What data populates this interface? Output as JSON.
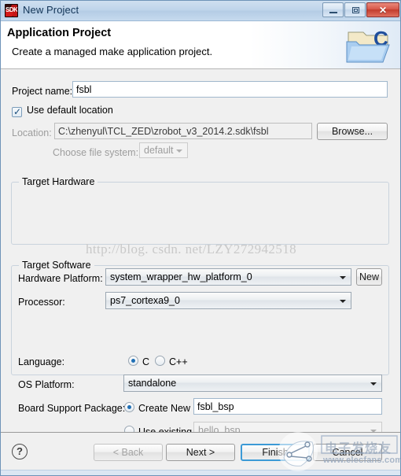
{
  "window": {
    "title": "New Project",
    "icon": "sdk-icon",
    "icon_text": "SDK",
    "minimize_label": "",
    "maximize_label": "",
    "close_label": "✕"
  },
  "header": {
    "title": "Application Project",
    "subtitle": "Create a managed make application project.",
    "icon": "c-folder-icon"
  },
  "form": {
    "project_name_label": "Project name:",
    "project_name_value": "fsbl",
    "use_default_location_label": "Use default location",
    "use_default_location_checked": true,
    "location_label": "Location:",
    "location_value": "C:\\zhenyul\\TCL_ZED\\zrobot_v3_2014.2.sdk\\fsbl",
    "browse_label": "Browse...",
    "choose_file_system_label": "Choose file system:",
    "file_system_value": "default"
  },
  "target_hardware": {
    "group_label": "Target Hardware",
    "hardware_platform_label": "Hardware Platform:",
    "hardware_platform_value": "system_wrapper_hw_platform_0",
    "new_button_label": "New",
    "processor_label": "Processor:",
    "processor_value": "ps7_cortexa9_0"
  },
  "target_software": {
    "group_label": "Target Software",
    "language_label": "Language:",
    "language_option_c": "C",
    "language_option_cpp": "C++",
    "language_selected": "C",
    "os_platform_label": "OS Platform:",
    "os_platform_value": "standalone",
    "bsp_label": "Board Support Package:",
    "bsp_create_new_label": "Create New",
    "bsp_create_new_value": "fsbl_bsp",
    "bsp_use_existing_label": "Use existing",
    "bsp_use_existing_value": "hello_bsp",
    "bsp_selected": "Create New"
  },
  "footer": {
    "help_label": "?",
    "back_label": "< Back",
    "back_enabled": false,
    "next_label": "Next >",
    "finish_label": "Finish",
    "cancel_label": "Cancel"
  },
  "watermarks": {
    "csdn": "http://blog. csdn. net/LZY272942518",
    "elecfans_cn": "电子发烧友",
    "elecfans_url": "www.elecfans.com"
  },
  "colors": {
    "accent": "#3c9ad6",
    "titlebar": "#bed4ea",
    "dialog_bg": "#f0f0f0"
  }
}
